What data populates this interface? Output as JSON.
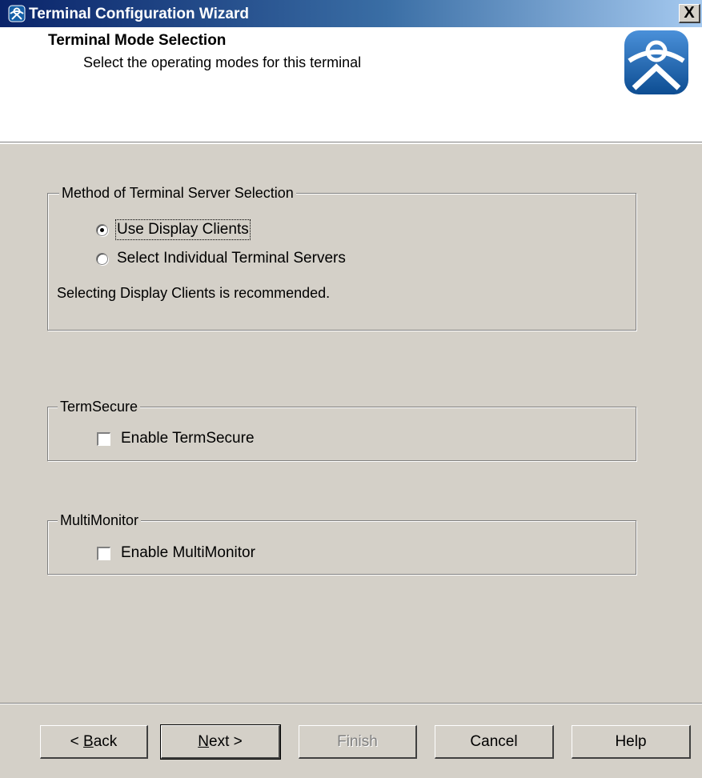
{
  "window": {
    "title": "Terminal Configuration Wizard",
    "close_symbol": "X",
    "app_icon": "thinmanager-logo-icon"
  },
  "header": {
    "title": "Terminal Mode Selection",
    "subtitle": "Select the operating modes for this terminal",
    "logo_icon": "thinmanager-logo-icon"
  },
  "server_selection": {
    "legend": "Method of Terminal Server Selection",
    "options": [
      {
        "label": "Use Display Clients",
        "checked": true
      },
      {
        "label": "Select Individual Terminal Servers",
        "checked": false
      }
    ],
    "note": "Selecting Display Clients is recommended."
  },
  "termsecure": {
    "legend": "TermSecure",
    "checkbox_label": "Enable TermSecure",
    "checked": false
  },
  "multimonitor": {
    "legend": "MultiMonitor",
    "checkbox_label": "Enable MultiMonitor",
    "checked": false
  },
  "buttons": {
    "back": {
      "prefix": "< ",
      "accel": "B",
      "rest": "ack"
    },
    "next": {
      "accel": "N",
      "rest": "ext >"
    },
    "finish": "Finish",
    "cancel": "Cancel",
    "help": "Help"
  },
  "colors": {
    "title_gradient_start": "#0a246a",
    "title_gradient_end": "#a6caf0",
    "dialog_background": "#d4d0c8",
    "logo_blue": "#1560a8"
  }
}
